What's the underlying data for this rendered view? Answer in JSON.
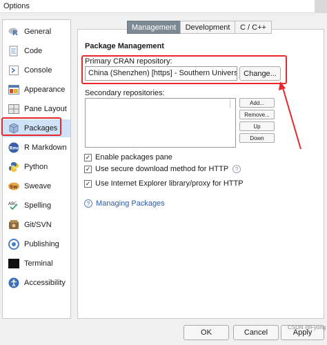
{
  "window": {
    "title": "Options"
  },
  "sidebar": {
    "items": [
      {
        "label": "General",
        "icon": "r-logo-icon"
      },
      {
        "label": "Code",
        "icon": "code-document-icon"
      },
      {
        "label": "Console",
        "icon": "console-prompt-icon"
      },
      {
        "label": "Appearance",
        "icon": "appearance-icon"
      },
      {
        "label": "Pane Layout",
        "icon": "pane-layout-icon"
      },
      {
        "label": "Packages",
        "icon": "packages-icon",
        "selected": true
      },
      {
        "label": "R Markdown",
        "icon": "rmd-icon"
      },
      {
        "label": "Python",
        "icon": "python-icon"
      },
      {
        "label": "Sweave",
        "icon": "sweave-icon"
      },
      {
        "label": "Spelling",
        "icon": "spelling-icon"
      },
      {
        "label": "Git/SVN",
        "icon": "git-icon"
      },
      {
        "label": "Publishing",
        "icon": "publishing-icon"
      },
      {
        "label": "Terminal",
        "icon": "terminal-icon"
      },
      {
        "label": "Accessibility",
        "icon": "accessibility-icon"
      }
    ]
  },
  "tabs": [
    {
      "label": "Management",
      "active": true
    },
    {
      "label": "Development",
      "active": false
    },
    {
      "label": "C / C++",
      "active": false
    }
  ],
  "management": {
    "section_title": "Package Management",
    "primary_repo_label": "Primary CRAN repository:",
    "primary_repo_value": "China (Shenzhen) [https] - Southern Universit",
    "change_button": "Change...",
    "secondary_repo_label": "Secondary repositories:",
    "secondary_buttons": {
      "add": "Add...",
      "remove": "Remove...",
      "up": "Up",
      "down": "Down"
    },
    "options": [
      {
        "label": "Enable packages pane",
        "checked": true
      },
      {
        "label": "Use secure download method for HTTP",
        "checked": true,
        "help": "?"
      },
      {
        "label": "Use Internet Explorer library/proxy for HTTP",
        "checked": true
      }
    ],
    "help_link": "Managing Packages",
    "help_icon": "?"
  },
  "footer": {
    "ok": "OK",
    "cancel": "Cancel",
    "apply": "Apply"
  },
  "watermark": "CSDN @Fyong",
  "colors": {
    "annotation_red": "#e8262b",
    "selected_bg": "#cfe2f7",
    "active_tab_bg": "#7d8a94",
    "link_blue": "#2a5aa8"
  }
}
